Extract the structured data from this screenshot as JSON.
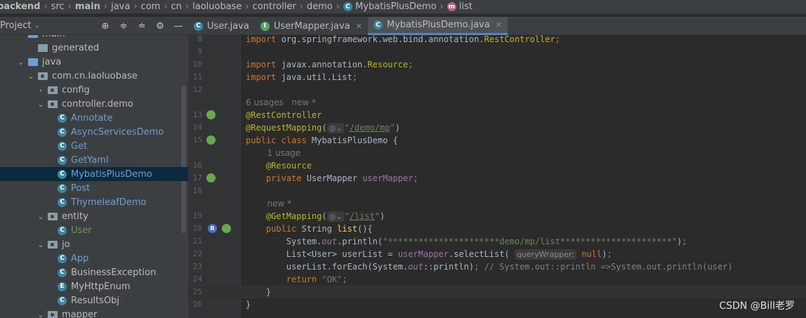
{
  "breadcrumb": [
    "backend",
    "src",
    "main",
    "java",
    "com",
    "cn",
    "laoluobase",
    "controller",
    "demo",
    "MybatisPlusDemo",
    "list"
  ],
  "project_panel": {
    "title": "Project",
    "tree": [
      {
        "label": "main",
        "depth": 2,
        "kind": "folder-blue",
        "arrow": "",
        "top_clipped": true
      },
      {
        "label": "generated",
        "depth": 3,
        "kind": "folder",
        "arrow": ""
      },
      {
        "label": "java",
        "depth": 2,
        "kind": "folder-blue",
        "arrow": "⌄"
      },
      {
        "label": "com.cn.laoluobase",
        "depth": 3,
        "kind": "package",
        "arrow": "⌄"
      },
      {
        "label": "config",
        "depth": 4,
        "kind": "package",
        "arrow": "›"
      },
      {
        "label": "controller.demo",
        "depth": 4,
        "kind": "package",
        "arrow": "⌄"
      },
      {
        "label": "Annotate",
        "depth": 5,
        "kind": "class",
        "arrow": "",
        "color": "blue"
      },
      {
        "label": "AsyncServicesDemo",
        "depth": 5,
        "kind": "class",
        "arrow": "",
        "color": "blue"
      },
      {
        "label": "Get",
        "depth": 5,
        "kind": "class",
        "arrow": "",
        "color": "blue"
      },
      {
        "label": "GetYaml",
        "depth": 5,
        "kind": "class",
        "arrow": "",
        "color": "blue"
      },
      {
        "label": "MybatisPlusDemo",
        "depth": 5,
        "kind": "class",
        "arrow": "",
        "color": "blue",
        "selected": true
      },
      {
        "label": "Post",
        "depth": 5,
        "kind": "class",
        "arrow": "",
        "color": "blue"
      },
      {
        "label": "ThymeleafDemo",
        "depth": 5,
        "kind": "class",
        "arrow": "",
        "color": "blue"
      },
      {
        "label": "entity",
        "depth": 4,
        "kind": "package",
        "arrow": "⌄"
      },
      {
        "label": "User",
        "depth": 5,
        "kind": "class",
        "arrow": "",
        "color": "green"
      },
      {
        "label": "jo",
        "depth": 4,
        "kind": "package",
        "arrow": "⌄"
      },
      {
        "label": "App",
        "depth": 5,
        "kind": "class",
        "arrow": "",
        "color": "blue"
      },
      {
        "label": "BusinessException",
        "depth": 5,
        "kind": "class",
        "arrow": ""
      },
      {
        "label": "MyHttpEnum",
        "depth": 5,
        "kind": "enum",
        "arrow": ""
      },
      {
        "label": "ResultsObj",
        "depth": 5,
        "kind": "class",
        "arrow": ""
      },
      {
        "label": "mapper",
        "depth": 4,
        "kind": "package",
        "arrow": "⌄"
      }
    ]
  },
  "tabs": [
    {
      "label": "User.java",
      "icon": "C",
      "active": false,
      "closable": false
    },
    {
      "label": "UserMapper.java",
      "icon": "I",
      "active": false,
      "closable": true
    },
    {
      "label": "MybatisPlusDemo.java",
      "icon": "C",
      "active": true,
      "closable": true
    }
  ],
  "editor": {
    "lines": [
      {
        "n": "8",
        "html": "<span class='kw'>import </span>org.springframework.web.bind.annotation.<span class='an'>RestController</span><span class='kw'>;</span>"
      },
      {
        "n": "9",
        "html": ""
      },
      {
        "n": "10",
        "html": "<span class='kw'>import </span>javax.annotation.<span class='an'>Resource</span><span class='kw'>;</span>"
      },
      {
        "n": "11",
        "html": "<span class='kw'>import </span>java.util.List<span class='kw'>;</span>"
      },
      {
        "n": "12",
        "html": ""
      },
      {
        "n": "",
        "hint": "6 usages   new *"
      },
      {
        "n": "13",
        "html": "<span class='an'>@RestController</span>",
        "gutter": "spring"
      },
      {
        "n": "14",
        "html": "<span class='an'>@RequestMapping</span>(<span class='param-hint'>◎⌄</span><span class='str'>\"</span><span class='url'>/demo/mp</span><span class='str'>\"</span>)"
      },
      {
        "n": "15",
        "html": "<span class='kw'>public class </span>MybatisPlusDemo {",
        "gutter": "spring"
      },
      {
        "n": "",
        "hint": "        1 usage"
      },
      {
        "n": "16",
        "html": "    <span class='an'>@Resource</span>"
      },
      {
        "n": "17",
        "html": "    <span class='kw'>private </span>UserMapper <span class='fld'>userMapper</span><span class='kw'>;</span>",
        "gutter": "spring"
      },
      {
        "n": "18",
        "html": ""
      },
      {
        "n": "",
        "hint": "        new *"
      },
      {
        "n": "19",
        "html": "    <span class='an'>@GetMapping</span>(<span class='param-hint'>◎⌄</span><span class='str'>\"</span><span class='url'>/list</span><span class='str'>\"</span>)"
      },
      {
        "n": "20",
        "html": "    <span class='kw'>public </span>String <span class='fn'>list</span>(){",
        "gutter": "r-spring"
      },
      {
        "n": "21",
        "html": "        System.<span class='fld'><i>out</i></span>.println(<span class='str'>\"**********************demo/mp/list**********************\"</span>)<span class='kw'>;</span>"
      },
      {
        "n": "22",
        "html": "        List&lt;User&gt; userList = <span class='fld'>userMapper</span>.selectList( <span class='param-hint'>queryWrapper:</span> <span class='kw'>null</span>)<span class='kw'>;</span>"
      },
      {
        "n": "23",
        "html": "        userList.forEach(System.<span class='fld'><i>out</i></span>::println)<span class='kw'>; </span><span class='cm'>// System.out::println =&gt;System.out.println(user)</span>"
      },
      {
        "n": "24",
        "html": "        <span class='kw'>return </span><span class='str'>\"OK\"</span><span class='kw'>;</span>"
      },
      {
        "n": "25",
        "html": "    }",
        "current": true
      },
      {
        "n": "26",
        "html": "}"
      }
    ]
  },
  "watermark": "CSDN @Bill老罗"
}
